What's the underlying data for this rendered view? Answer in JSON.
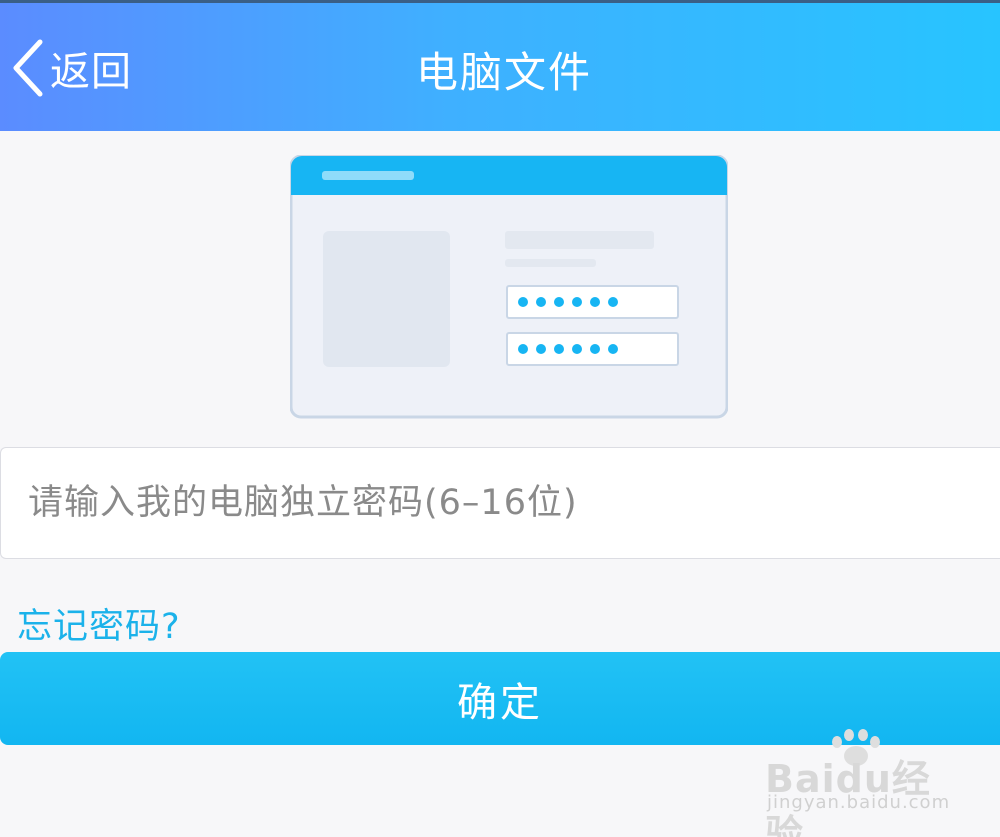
{
  "header": {
    "back_label": "返回",
    "title": "电脑文件"
  },
  "icons": {
    "back": "chevron-left-icon",
    "illustration": "pc-login-illustration",
    "watermark": "baidu-paw-icon"
  },
  "form": {
    "password_placeholder": "请输入我的电脑独立密码(6–16位)",
    "password_value": "",
    "forgot_label": "忘记密码?",
    "confirm_label": "确定"
  },
  "watermark": {
    "logo_text": "Baidu经验",
    "url": "jingyan.baidu.com"
  },
  "colors": {
    "header_start": "#5b8cff",
    "header_end": "#27c4ff",
    "accent": "#1bb2ea",
    "button": "#16b8f2"
  }
}
